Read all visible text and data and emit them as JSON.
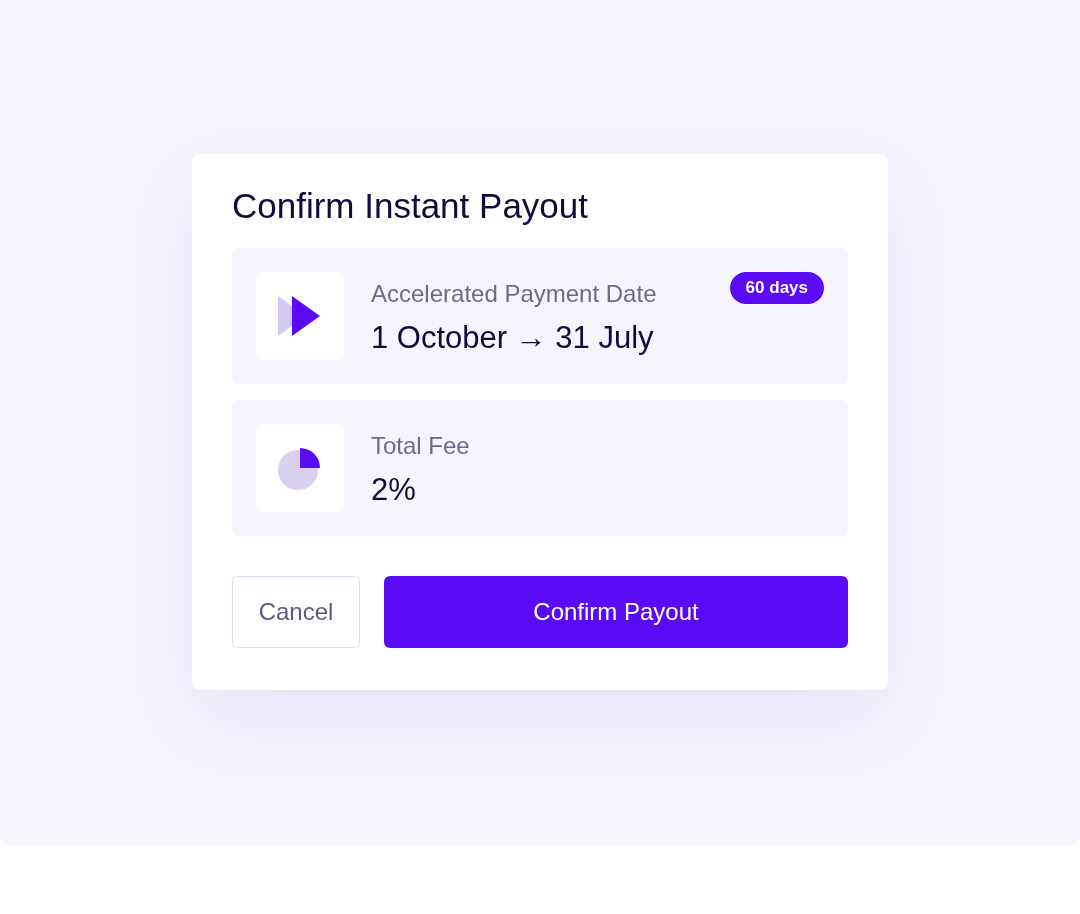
{
  "dialog": {
    "title": "Confirm Instant Payout",
    "items": [
      {
        "kind": "date",
        "label": "Accelerated Payment Date",
        "value": "1 October → 31 July",
        "badge": "60 days"
      },
      {
        "kind": "fee",
        "label": "Total Fee",
        "value": "2%"
      }
    ],
    "buttons": [
      {
        "kind": "secondary",
        "label": "Cancel"
      },
      {
        "kind": "primary",
        "label": "Confirm Payout"
      }
    ]
  }
}
